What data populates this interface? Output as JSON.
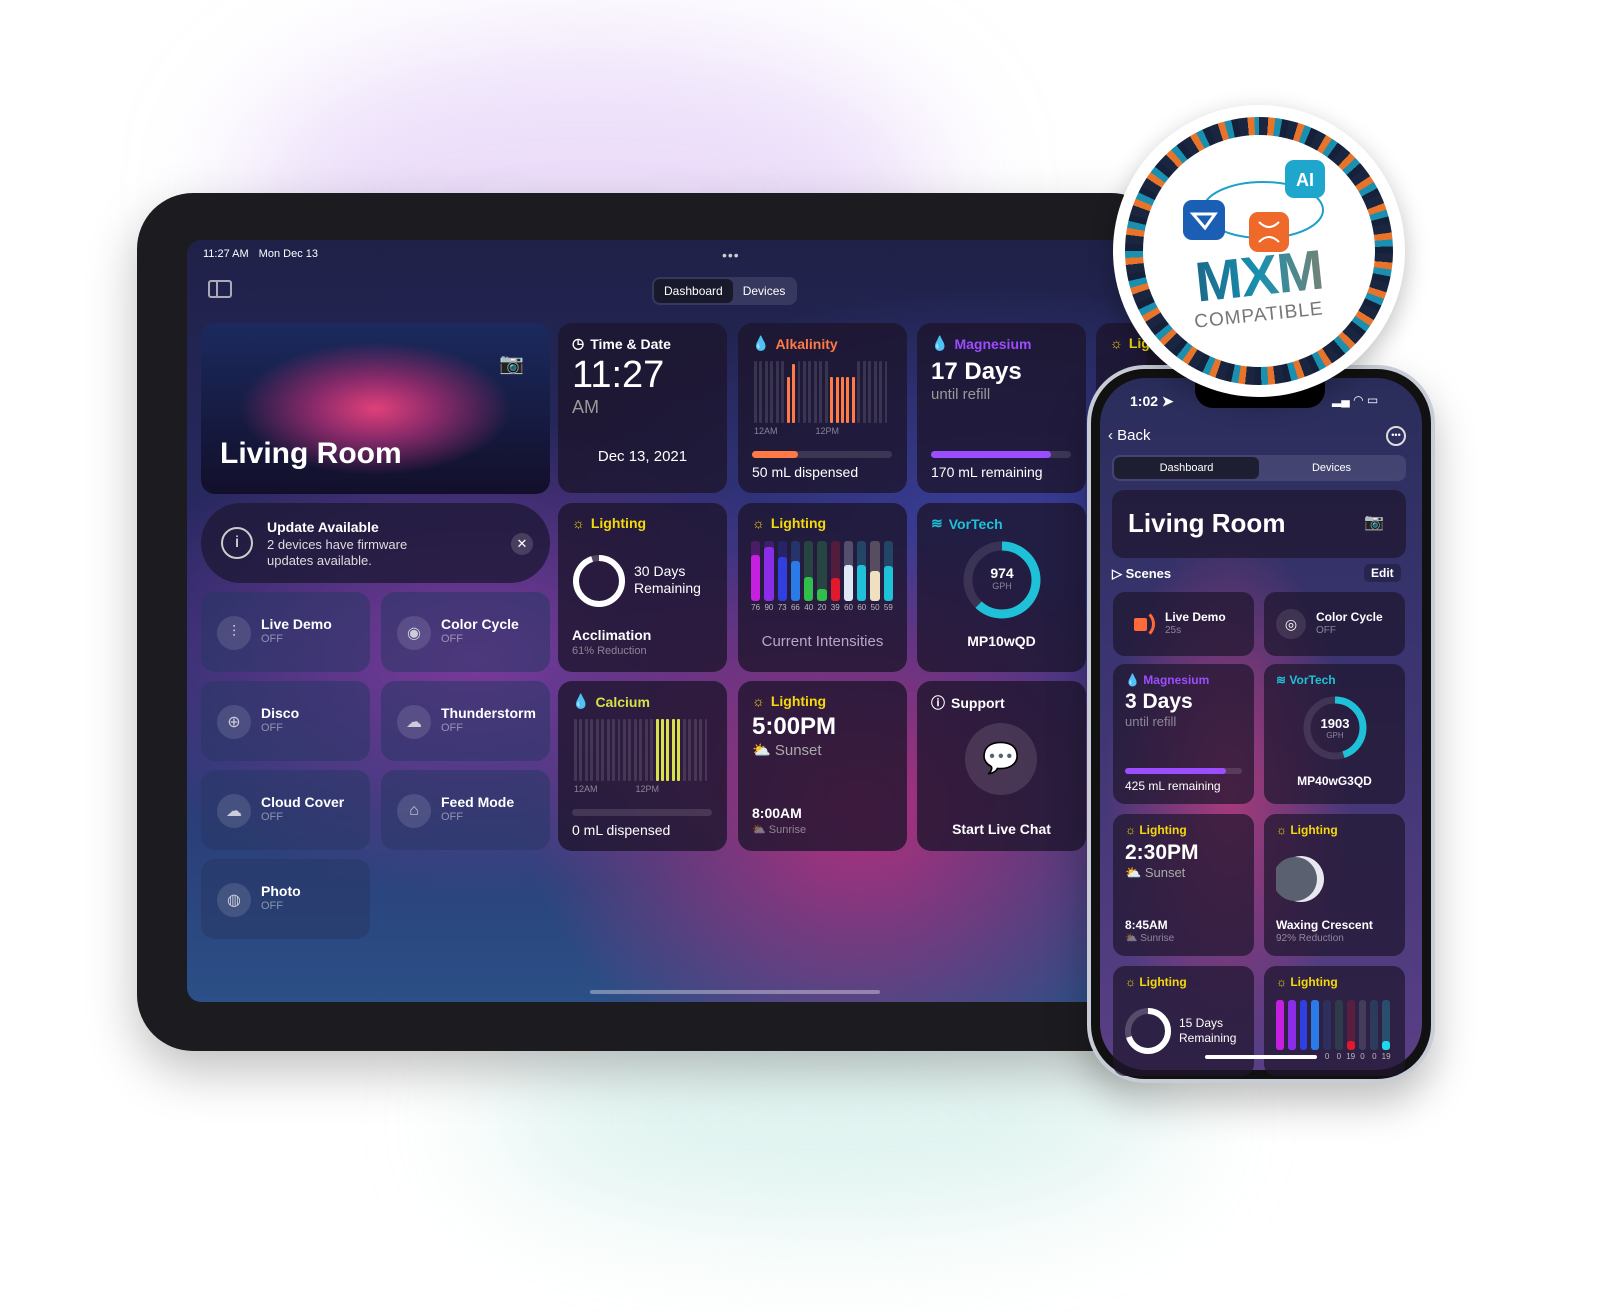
{
  "colors": {
    "alkalinity": "#ff7a45",
    "magnesium": "#9b4dff",
    "lighting": "#f5d90a",
    "vortech": "#1fc1d8",
    "calcium": "#d8e04a"
  },
  "badge": {
    "brand": "MXM",
    "subtitle": "COMPATIBLE"
  },
  "tablet": {
    "status": {
      "time": "11:27 AM",
      "date": "Mon Dec 13"
    },
    "tabs": [
      "Dashboard",
      "Devices"
    ],
    "hero": {
      "title": "Living Room"
    },
    "update": {
      "title": "Update Available",
      "message": "2 devices have firmware updates available."
    },
    "scenes": [
      {
        "name": "Live Demo",
        "status": "OFF",
        "icon": "sliders-icon"
      },
      {
        "name": "Color Cycle",
        "status": "OFF",
        "icon": "circle-icon"
      },
      {
        "name": "Disco",
        "status": "OFF",
        "icon": "globe-icon"
      },
      {
        "name": "Thunderstorm",
        "status": "OFF",
        "icon": "storm-icon"
      },
      {
        "name": "Cloud Cover",
        "status": "OFF",
        "icon": "cloud-icon"
      },
      {
        "name": "Feed Mode",
        "status": "OFF",
        "icon": "feed-icon"
      },
      {
        "name": "Photo",
        "status": "OFF",
        "icon": "photo-icon"
      }
    ],
    "time_card": {
      "title": "Time & Date",
      "time": "11:27",
      "ampm": "AM",
      "date": "Dec 13, 2021"
    },
    "alkalinity": {
      "title": "Alkalinity",
      "axis": [
        "12AM",
        "12PM"
      ],
      "levels": [
        0,
        0,
        0,
        0,
        0,
        0,
        0.75,
        0.95,
        0,
        0,
        0,
        0,
        0,
        0,
        0.75,
        0.75,
        0.75,
        0.75,
        0.75,
        0,
        0,
        0,
        0,
        0,
        0
      ],
      "dispensed": "50 mL dispensed",
      "progress": 0.33
    },
    "magnesium": {
      "title": "Magnesium",
      "value": "17 Days",
      "sub": "until refill",
      "remaining": "170 mL remaining",
      "progress": 0.86
    },
    "lighting_partial": {
      "title": "Lig"
    },
    "acclimation": {
      "title": "Lighting",
      "days": "30 Days",
      "remaining": "Remaining",
      "label": "Acclimation",
      "reduction": "61% Reduction",
      "progress": 0.95
    },
    "intensities": {
      "title": "Lighting",
      "values": [
        76,
        90,
        73,
        66,
        40,
        20,
        39,
        60,
        60,
        50,
        59
      ],
      "colors": [
        "#c51fe0",
        "#8a2ce8",
        "#2f3fe0",
        "#2a7ae8",
        "#2fbf4a",
        "#2fbf4a",
        "#e01a2a",
        "#dfe8f5",
        "#1fc1d8",
        "#eee0c0",
        "#1fc1d8"
      ],
      "label": "Current Intensities"
    },
    "vortech": {
      "title": "VorTech",
      "value": "974",
      "unit": "GPH",
      "model": "MP10wQD",
      "progress": 0.62
    },
    "calcium": {
      "title": "Calcium",
      "axis": [
        "12AM",
        "12PM"
      ],
      "levels": [
        0,
        0,
        0,
        0,
        0,
        0,
        0,
        0,
        0,
        0,
        0,
        0,
        0,
        0,
        0,
        1,
        1,
        1,
        1,
        1,
        0,
        0,
        0,
        0,
        0
      ],
      "dispensed": "0 mL dispensed",
      "progress": 0
    },
    "schedule": {
      "title": "Lighting",
      "sunset_time": "5:00PM",
      "sunset": "Sunset",
      "sunrise_time": "8:00AM",
      "sunrise": "Sunrise"
    },
    "support": {
      "title": "Support",
      "action": "Start Live Chat"
    }
  },
  "phone": {
    "time": "1:02",
    "back": "Back",
    "tabs": [
      "Dashboard",
      "Devices"
    ],
    "hero": {
      "title": "Living Room"
    },
    "scenes_label": "Scenes",
    "edit": "Edit",
    "scenes": [
      {
        "name": "Live Demo",
        "status": "25s"
      },
      {
        "name": "Color Cycle",
        "status": "OFF"
      }
    ],
    "magnesium": {
      "title": "Magnesium",
      "value": "3 Days",
      "sub": "until refill",
      "remaining": "425 mL remaining",
      "progress": 0.86
    },
    "vortech": {
      "title": "VorTech",
      "value": "1903",
      "unit": "GPH",
      "model": "MP40wG3QD",
      "progress": 0.45
    },
    "schedule": {
      "title": "Lighting",
      "sunset_time": "2:30PM",
      "sunset": "Sunset",
      "sunrise_time": "8:45AM",
      "sunrise": "Sunrise"
    },
    "moon": {
      "title": "Lighting",
      "phase": "Waxing Crescent",
      "reduction": "92% Reduction"
    },
    "acclimation": {
      "title": "Lighting",
      "days": "15 Days",
      "remaining": "Remaining",
      "progress": 0.7
    },
    "intensities": {
      "title": "Lighting",
      "levels": [
        1,
        1,
        1,
        1,
        0,
        0,
        0.19,
        0,
        0,
        0.19
      ],
      "labels": [
        "",
        "",
        "",
        "",
        "0",
        "0",
        "19",
        "0",
        "0",
        "19"
      ],
      "colors": [
        "#c51fe0",
        "#8a2ce8",
        "#2f3fe0",
        "#2a7ae8",
        "#2a5ea8",
        "#2f8a5a",
        "#e01a2a",
        "#8a8fa0",
        "#2a8aa0",
        "#1fd8e8"
      ]
    }
  }
}
